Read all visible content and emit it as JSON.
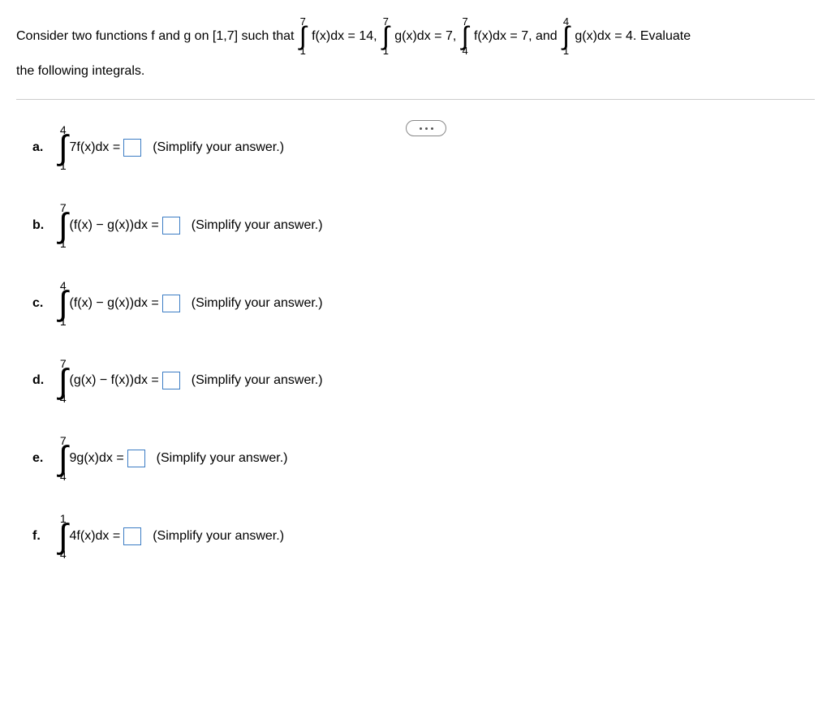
{
  "problem": {
    "prefix": "Consider two functions f and g on [1,7] such that ",
    "int1_upper": "7",
    "int1_lower": "1",
    "int1_body": "f(x)dx = 14, ",
    "int2_upper": "7",
    "int2_lower": "1",
    "int2_body": "g(x)dx = 7, ",
    "int3_upper": "7",
    "int3_lower": "4",
    "int3_body": "f(x)dx = 7, ",
    "and_text": "and ",
    "int4_upper": "4",
    "int4_lower": "1",
    "int4_body": "g(x)dx = 4.  ",
    "suffix": "Evaluate",
    "line2": "the following integrals."
  },
  "simplify_text": "(Simplify your answer.)",
  "questions": {
    "a": {
      "label": "a.",
      "upper": "4",
      "lower": "1",
      "integrand": "7f(x)dx ="
    },
    "b": {
      "label": "b.",
      "upper": "7",
      "lower": "1",
      "integrand": "(f(x) − g(x))dx ="
    },
    "c": {
      "label": "c.",
      "upper": "4",
      "lower": "1",
      "integrand": "(f(x) − g(x))dx ="
    },
    "d": {
      "label": "d.",
      "upper": "7",
      "lower": "4",
      "integrand": "(g(x) − f(x))dx ="
    },
    "e": {
      "label": "e.",
      "upper": "7",
      "lower": "4",
      "integrand": "9g(x)dx ="
    },
    "f": {
      "label": "f.",
      "upper": "1",
      "lower": "4",
      "integrand": "4f(x)dx ="
    }
  }
}
